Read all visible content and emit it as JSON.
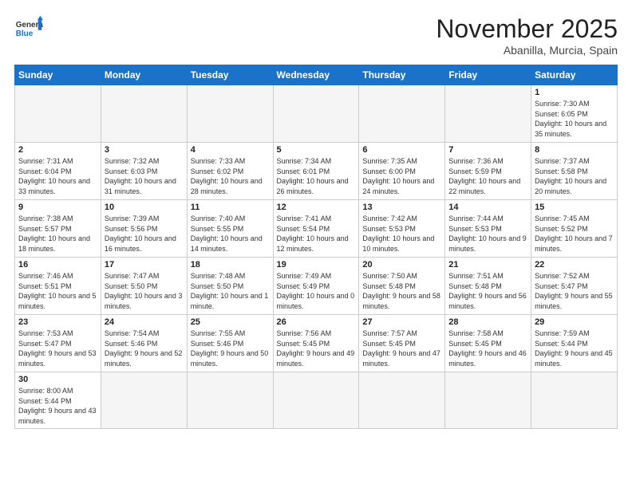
{
  "header": {
    "logo_general": "General",
    "logo_blue": "Blue",
    "month_title": "November 2025",
    "location": "Abanilla, Murcia, Spain"
  },
  "days_of_week": [
    "Sunday",
    "Monday",
    "Tuesday",
    "Wednesday",
    "Thursday",
    "Friday",
    "Saturday"
  ],
  "weeks": [
    [
      {
        "num": "",
        "info": ""
      },
      {
        "num": "",
        "info": ""
      },
      {
        "num": "",
        "info": ""
      },
      {
        "num": "",
        "info": ""
      },
      {
        "num": "",
        "info": ""
      },
      {
        "num": "",
        "info": ""
      },
      {
        "num": "1",
        "info": "Sunrise: 7:30 AM\nSunset: 6:05 PM\nDaylight: 10 hours and 35 minutes."
      }
    ],
    [
      {
        "num": "2",
        "info": "Sunrise: 7:31 AM\nSunset: 6:04 PM\nDaylight: 10 hours and 33 minutes."
      },
      {
        "num": "3",
        "info": "Sunrise: 7:32 AM\nSunset: 6:03 PM\nDaylight: 10 hours and 31 minutes."
      },
      {
        "num": "4",
        "info": "Sunrise: 7:33 AM\nSunset: 6:02 PM\nDaylight: 10 hours and 28 minutes."
      },
      {
        "num": "5",
        "info": "Sunrise: 7:34 AM\nSunset: 6:01 PM\nDaylight: 10 hours and 26 minutes."
      },
      {
        "num": "6",
        "info": "Sunrise: 7:35 AM\nSunset: 6:00 PM\nDaylight: 10 hours and 24 minutes."
      },
      {
        "num": "7",
        "info": "Sunrise: 7:36 AM\nSunset: 5:59 PM\nDaylight: 10 hours and 22 minutes."
      },
      {
        "num": "8",
        "info": "Sunrise: 7:37 AM\nSunset: 5:58 PM\nDaylight: 10 hours and 20 minutes."
      }
    ],
    [
      {
        "num": "9",
        "info": "Sunrise: 7:38 AM\nSunset: 5:57 PM\nDaylight: 10 hours and 18 minutes."
      },
      {
        "num": "10",
        "info": "Sunrise: 7:39 AM\nSunset: 5:56 PM\nDaylight: 10 hours and 16 minutes."
      },
      {
        "num": "11",
        "info": "Sunrise: 7:40 AM\nSunset: 5:55 PM\nDaylight: 10 hours and 14 minutes."
      },
      {
        "num": "12",
        "info": "Sunrise: 7:41 AM\nSunset: 5:54 PM\nDaylight: 10 hours and 12 minutes."
      },
      {
        "num": "13",
        "info": "Sunrise: 7:42 AM\nSunset: 5:53 PM\nDaylight: 10 hours and 10 minutes."
      },
      {
        "num": "14",
        "info": "Sunrise: 7:44 AM\nSunset: 5:53 PM\nDaylight: 10 hours and 9 minutes."
      },
      {
        "num": "15",
        "info": "Sunrise: 7:45 AM\nSunset: 5:52 PM\nDaylight: 10 hours and 7 minutes."
      }
    ],
    [
      {
        "num": "16",
        "info": "Sunrise: 7:46 AM\nSunset: 5:51 PM\nDaylight: 10 hours and 5 minutes."
      },
      {
        "num": "17",
        "info": "Sunrise: 7:47 AM\nSunset: 5:50 PM\nDaylight: 10 hours and 3 minutes."
      },
      {
        "num": "18",
        "info": "Sunrise: 7:48 AM\nSunset: 5:50 PM\nDaylight: 10 hours and 1 minute."
      },
      {
        "num": "19",
        "info": "Sunrise: 7:49 AM\nSunset: 5:49 PM\nDaylight: 10 hours and 0 minutes."
      },
      {
        "num": "20",
        "info": "Sunrise: 7:50 AM\nSunset: 5:48 PM\nDaylight: 9 hours and 58 minutes."
      },
      {
        "num": "21",
        "info": "Sunrise: 7:51 AM\nSunset: 5:48 PM\nDaylight: 9 hours and 56 minutes."
      },
      {
        "num": "22",
        "info": "Sunrise: 7:52 AM\nSunset: 5:47 PM\nDaylight: 9 hours and 55 minutes."
      }
    ],
    [
      {
        "num": "23",
        "info": "Sunrise: 7:53 AM\nSunset: 5:47 PM\nDaylight: 9 hours and 53 minutes."
      },
      {
        "num": "24",
        "info": "Sunrise: 7:54 AM\nSunset: 5:46 PM\nDaylight: 9 hours and 52 minutes."
      },
      {
        "num": "25",
        "info": "Sunrise: 7:55 AM\nSunset: 5:46 PM\nDaylight: 9 hours and 50 minutes."
      },
      {
        "num": "26",
        "info": "Sunrise: 7:56 AM\nSunset: 5:45 PM\nDaylight: 9 hours and 49 minutes."
      },
      {
        "num": "27",
        "info": "Sunrise: 7:57 AM\nSunset: 5:45 PM\nDaylight: 9 hours and 47 minutes."
      },
      {
        "num": "28",
        "info": "Sunrise: 7:58 AM\nSunset: 5:45 PM\nDaylight: 9 hours and 46 minutes."
      },
      {
        "num": "29",
        "info": "Sunrise: 7:59 AM\nSunset: 5:44 PM\nDaylight: 9 hours and 45 minutes."
      }
    ],
    [
      {
        "num": "30",
        "info": "Sunrise: 8:00 AM\nSunset: 5:44 PM\nDaylight: 9 hours and 43 minutes."
      },
      {
        "num": "",
        "info": ""
      },
      {
        "num": "",
        "info": ""
      },
      {
        "num": "",
        "info": ""
      },
      {
        "num": "",
        "info": ""
      },
      {
        "num": "",
        "info": ""
      },
      {
        "num": "",
        "info": ""
      }
    ]
  ]
}
